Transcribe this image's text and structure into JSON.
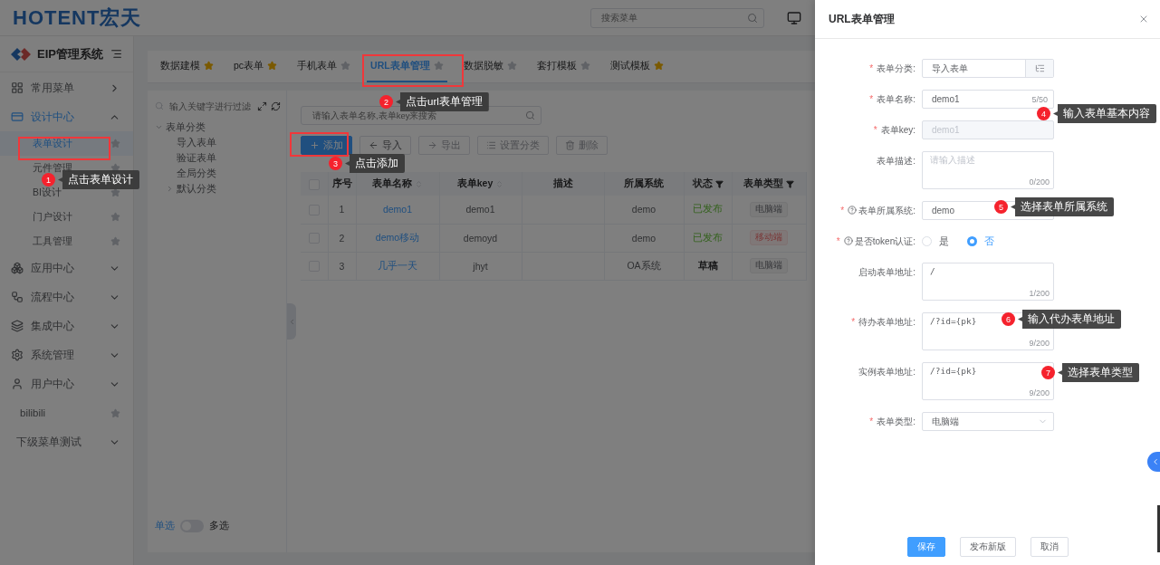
{
  "header": {
    "logo": "HOTENT宏天",
    "search_placeholder": "搜索菜单"
  },
  "sidebar": {
    "title": "EIP管理系统",
    "items": [
      {
        "label": "常用菜单",
        "kind": "popout",
        "expanded": false
      },
      {
        "label": "设计中心",
        "kind": "group",
        "expanded": true,
        "children": [
          {
            "label": "表单设计",
            "selected": true,
            "starred": false
          },
          {
            "label": "元件管理",
            "selected": false,
            "starred": false
          },
          {
            "label": "BI设计",
            "selected": false,
            "starred": false
          },
          {
            "label": "门户设计",
            "selected": false,
            "starred": false
          },
          {
            "label": "工具管理",
            "selected": false,
            "starred": false
          }
        ]
      },
      {
        "label": "应用中心",
        "kind": "group",
        "expanded": false
      },
      {
        "label": "流程中心",
        "kind": "group",
        "expanded": false
      },
      {
        "label": "集成中心",
        "kind": "group",
        "expanded": false
      },
      {
        "label": "系统管理",
        "kind": "group",
        "expanded": false
      },
      {
        "label": "用户中心",
        "kind": "group",
        "expanded": false
      },
      {
        "label": "bilibili",
        "kind": "link",
        "starred": false
      },
      {
        "label": "下级菜单测试",
        "kind": "plain-group",
        "expanded": false
      }
    ]
  },
  "tabs": [
    {
      "label": "数据建模",
      "selected": false,
      "starred": true
    },
    {
      "label": "pc表单",
      "selected": false,
      "starred": true
    },
    {
      "label": "手机表单",
      "selected": false,
      "starred": false
    },
    {
      "label": "URL表单管理",
      "selected": true,
      "starred": false
    },
    {
      "label": "数据脱敏",
      "selected": false,
      "starred": false
    },
    {
      "label": "套打模板",
      "selected": false,
      "starred": false
    },
    {
      "label": "测试模板",
      "selected": false,
      "starred": true
    }
  ],
  "tree": {
    "filter_placeholder": "输入关键字进行过滤",
    "nodes": [
      {
        "label": "表单分类",
        "kind": "folder",
        "expanded": true,
        "children": [
          {
            "label": "导入表单",
            "kind": "leaf"
          },
          {
            "label": "验证表单",
            "kind": "leaf"
          },
          {
            "label": "全局分类",
            "kind": "leaf"
          },
          {
            "label": "默认分类",
            "kind": "folder",
            "expanded": false
          }
        ]
      }
    ],
    "selection_switch": {
      "left": "单选",
      "right": "多选",
      "on": false
    }
  },
  "search_placeholder": "请输入表单名称,表单key来搜索",
  "toolbar": [
    {
      "label": "添加",
      "kind": "primary",
      "disabled": false
    },
    {
      "label": "导入",
      "kind": "import",
      "disabled": false
    },
    {
      "label": "导出",
      "kind": "export",
      "disabled": true
    },
    {
      "label": "设置分类",
      "kind": "category",
      "disabled": true
    },
    {
      "label": "删除",
      "kind": "delete",
      "disabled": true
    }
  ],
  "table": {
    "select_all_checked": false,
    "columns": [
      {
        "label": "序号",
        "kind": "plain"
      },
      {
        "label": "表单名称",
        "kind": "sort"
      },
      {
        "label": "表单key",
        "kind": "sort"
      },
      {
        "label": "描述",
        "kind": "plain"
      },
      {
        "label": "所属系统",
        "kind": "plain"
      },
      {
        "label": "状态",
        "kind": "filter"
      },
      {
        "label": "表单类型",
        "kind": "filter"
      }
    ],
    "rows": [
      {
        "checked": false,
        "index": "1",
        "name": "demo1",
        "key": "demo1",
        "system": "demo",
        "status": {
          "text": "已发布",
          "kind": "published"
        },
        "type": {
          "text": "电脑端",
          "kind": "pc"
        }
      },
      {
        "checked": false,
        "index": "2",
        "name": "demo移动",
        "key": "demoyd",
        "system": "demo",
        "status": {
          "text": "已发布",
          "kind": "published"
        },
        "type": {
          "text": "移动端",
          "kind": "mobile"
        }
      },
      {
        "checked": false,
        "index": "3",
        "name": "几乎一天",
        "key": "jhyt",
        "system": "OA系统",
        "status": {
          "text": "草稿",
          "kind": "draft"
        },
        "type": {
          "text": "电脑端",
          "kind": "pc"
        }
      }
    ]
  },
  "drawer": {
    "title": "URL表单管理",
    "required_mark": "*",
    "fields": [
      {
        "label": "表单分类:",
        "required": true,
        "help": false,
        "kind": "picker",
        "value": "导入表单"
      },
      {
        "label": "表单名称:",
        "required": true,
        "help": false,
        "kind": "input",
        "value": "demo1",
        "counter": "5/50",
        "disabled": false
      },
      {
        "label": "表单key:",
        "required": true,
        "help": false,
        "kind": "input",
        "value": "demo1",
        "disabled": true
      },
      {
        "label": "表单描述:",
        "required": false,
        "help": false,
        "kind": "textarea",
        "placeholder": "请输入描述",
        "counter": "0/200"
      },
      {
        "label": "表单所属系统:",
        "required": true,
        "help": true,
        "kind": "input",
        "value": "demo",
        "disabled": false
      },
      {
        "label": "是否token认证:",
        "required": true,
        "help": true,
        "kind": "radio",
        "options": [
          {
            "label": "是",
            "selected": false
          },
          {
            "label": "否",
            "selected": true
          }
        ]
      },
      {
        "label": "启动表单地址:",
        "required": false,
        "help": false,
        "kind": "textarea",
        "value": "/",
        "counter": "1/200"
      },
      {
        "label": "待办表单地址:",
        "required": true,
        "help": false,
        "kind": "textarea",
        "value": "/?id={pk}",
        "counter": "9/200"
      },
      {
        "label": "实例表单地址:",
        "required": false,
        "help": false,
        "kind": "textarea",
        "value": "/?id={pk}",
        "counter": "9/200"
      },
      {
        "label": "表单类型:",
        "required": true,
        "help": false,
        "kind": "select",
        "value": "电脑端"
      }
    ],
    "buttons": [
      {
        "label": "保存",
        "kind": "primary"
      },
      {
        "label": "发布新版",
        "kind": "default"
      },
      {
        "label": "取消",
        "kind": "default"
      }
    ]
  },
  "annotations": [
    {
      "number": "1",
      "text": "点击表单设计",
      "framed": true
    },
    {
      "number": "2",
      "text": "点击url表单管理",
      "framed": true
    },
    {
      "number": "3",
      "text": "点击添加",
      "framed": true
    },
    {
      "number": "4",
      "text": "输入表单基本内容",
      "framed": false
    },
    {
      "number": "5",
      "text": "选择表单所属系统",
      "framed": false
    },
    {
      "number": "6",
      "text": "输入代办表单地址",
      "framed": false
    },
    {
      "number": "7",
      "text": "选择表单类型",
      "framed": false
    }
  ]
}
